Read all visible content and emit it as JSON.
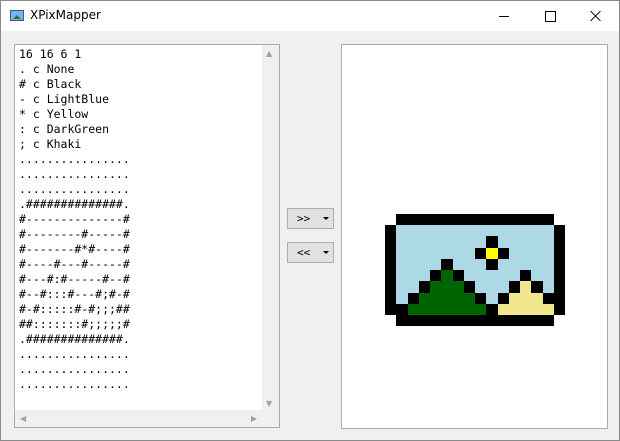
{
  "window": {
    "title": "XPixMapper",
    "icon": "picture-icon",
    "controls": {
      "minimize": "minimize-icon",
      "maximize": "maximize-icon",
      "close": "close-icon"
    }
  },
  "editor": {
    "text": "16 16 6 1\n. c None\n# c Black\n- c LightBlue\n* c Yellow\n: c DarkGreen\n; c Khaki\n................\n................\n................\n.##############.\n#--------------#\n#--------#-----#\n#-------#*#----#\n#----#---#-----#\n#---#:#-----#--#\n#--#:::#---#;#-#\n#-#:::::#-#;;;##\n##:::::::#;;;;;#\n.##############.\n................\n................\n................"
  },
  "buttons": {
    "to_image": ">>",
    "to_text": "<<"
  },
  "colors": {
    "None": "#ffffff",
    "Black": "#000000",
    "LightBlue": "#add8e6",
    "Yellow": "#ffff00",
    "DarkGreen": "#006400",
    "Khaki": "#f0e68c"
  }
}
